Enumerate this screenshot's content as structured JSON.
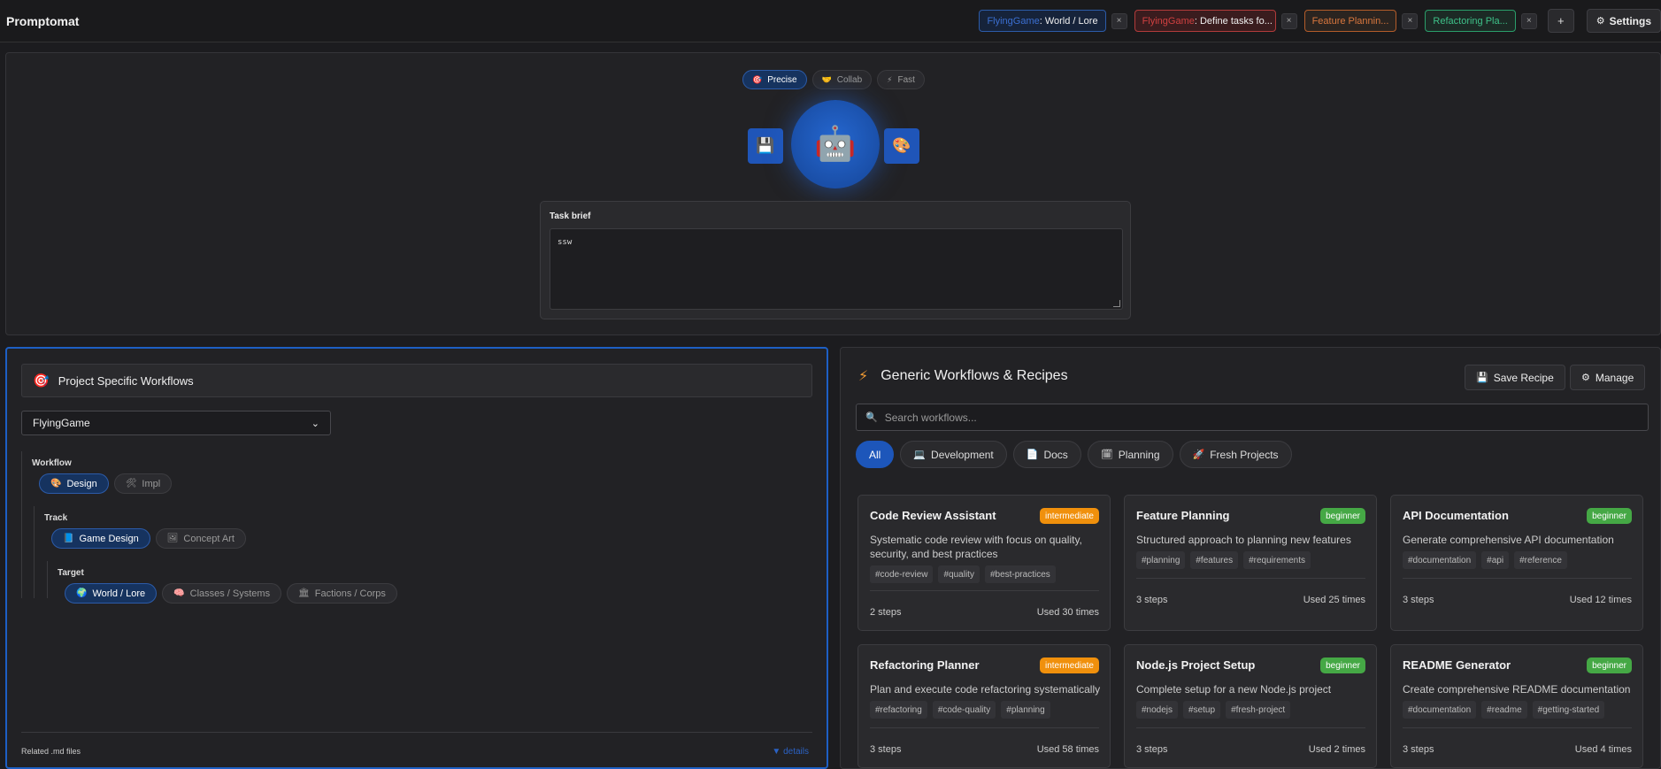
{
  "app": {
    "title": "Promptomat"
  },
  "tabs": [
    {
      "prefix": "FlyingGame",
      "suffix": ": World / Lore",
      "border": "#2c5ba8",
      "prefix_color": "#3b6fd1",
      "bg": "#16233a"
    },
    {
      "prefix": "FlyingGame",
      "suffix": ": Define tasks fo...",
      "border": "#b23b3b",
      "prefix_color": "#d04040",
      "bg": "#3a1c1e"
    },
    {
      "prefix": "",
      "suffix": "Feature Plannin...",
      "border": "#b35c2a",
      "prefix_color": "#d9773e",
      "bg": "#2a2420",
      "text_color": "#d9773e"
    },
    {
      "prefix": "",
      "suffix": "Refactoring Pla...",
      "border": "#2a9e6a",
      "prefix_color": "#3ec088",
      "bg": "#1c2a25",
      "text_color": "#3ec088"
    }
  ],
  "tab_close": "×",
  "tab_add": "+",
  "settings": {
    "label": "Settings",
    "icon": "⚙"
  },
  "modes": [
    {
      "label": "Precise",
      "icon": "🎯",
      "active": true
    },
    {
      "label": "Collab",
      "icon": "🤝",
      "active": false
    },
    {
      "label": "Fast",
      "icon": "⚡",
      "active": false
    }
  ],
  "hero": {
    "save_icon": "💾",
    "robot_icon": "🤖",
    "palette_icon": "🎨"
  },
  "brief": {
    "label": "Task brief",
    "value": "ssw"
  },
  "project_panel": {
    "title": "Project Specific Workflows",
    "icon": "🎯",
    "project": "FlyingGame",
    "chevron": "⌄",
    "workflow": {
      "label": "Workflow",
      "items": [
        {
          "label": "Design",
          "icon": "🎨",
          "active": true
        },
        {
          "label": "Impl",
          "icon": "🛠",
          "active": false
        }
      ]
    },
    "track": {
      "label": "Track",
      "items": [
        {
          "label": "Game Design",
          "icon": "📘",
          "active": true
        },
        {
          "label": "Concept Art",
          "icon": "🖼",
          "active": false
        }
      ]
    },
    "target": {
      "label": "Target",
      "items": [
        {
          "label": "World / Lore",
          "icon": "🌍",
          "active": true
        },
        {
          "label": "Classes / Systems",
          "icon": "🧠",
          "active": false
        },
        {
          "label": "Factions / Corps",
          "icon": "🏛",
          "active": false
        }
      ]
    },
    "related": "Related .md files",
    "details": "▼ details"
  },
  "generic_panel": {
    "title": "Generic Workflows & Recipes",
    "icon": "⚡",
    "save_recipe": {
      "label": "Save Recipe",
      "icon": "💾"
    },
    "manage": {
      "label": "Manage",
      "icon": "⚙"
    },
    "search_placeholder": "Search workflows...",
    "search_icon": "🔍",
    "categories": [
      {
        "label": "All",
        "icon": "",
        "active": true
      },
      {
        "label": "Development",
        "icon": "💻",
        "active": false
      },
      {
        "label": "Docs",
        "icon": "📄",
        "active": false
      },
      {
        "label": "Planning",
        "icon": "🗓",
        "active": false
      },
      {
        "label": "Fresh Projects",
        "icon": "🚀",
        "active": false
      }
    ],
    "cards": [
      {
        "title": "Code Review Assistant",
        "level": "intermediate",
        "level_color": "#f0900c",
        "desc": "Systematic code review with focus on quality, security, and best practices",
        "tags": [
          "#code-review",
          "#quality",
          "#best-practices"
        ],
        "steps": "2 steps",
        "used": "Used 30 times"
      },
      {
        "title": "Feature Planning",
        "level": "beginner",
        "level_color": "#45a845",
        "desc": "Structured approach to planning new features",
        "tags": [
          "#planning",
          "#features",
          "#requirements"
        ],
        "steps": "3 steps",
        "used": "Used 25 times"
      },
      {
        "title": "API Documentation",
        "level": "beginner",
        "level_color": "#45a845",
        "desc": "Generate comprehensive API documentation",
        "tags": [
          "#documentation",
          "#api",
          "#reference"
        ],
        "steps": "3 steps",
        "used": "Used 12 times"
      },
      {
        "title": "Refactoring Planner",
        "level": "intermediate",
        "level_color": "#f0900c",
        "desc": "Plan and execute code refactoring systematically",
        "tags": [
          "#refactoring",
          "#code-quality",
          "#planning"
        ],
        "steps": "3 steps",
        "used": "Used 58 times"
      },
      {
        "title": "Node.js Project Setup",
        "level": "beginner",
        "level_color": "#45a845",
        "desc": "Complete setup for a new Node.js project",
        "tags": [
          "#nodejs",
          "#setup",
          "#fresh-project"
        ],
        "steps": "3 steps",
        "used": "Used 2 times"
      },
      {
        "title": "README Generator",
        "level": "beginner",
        "level_color": "#45a845",
        "desc": "Create comprehensive README documentation",
        "tags": [
          "#documentation",
          "#readme",
          "#getting-started"
        ],
        "steps": "3 steps",
        "used": "Used 4 times"
      }
    ]
  }
}
